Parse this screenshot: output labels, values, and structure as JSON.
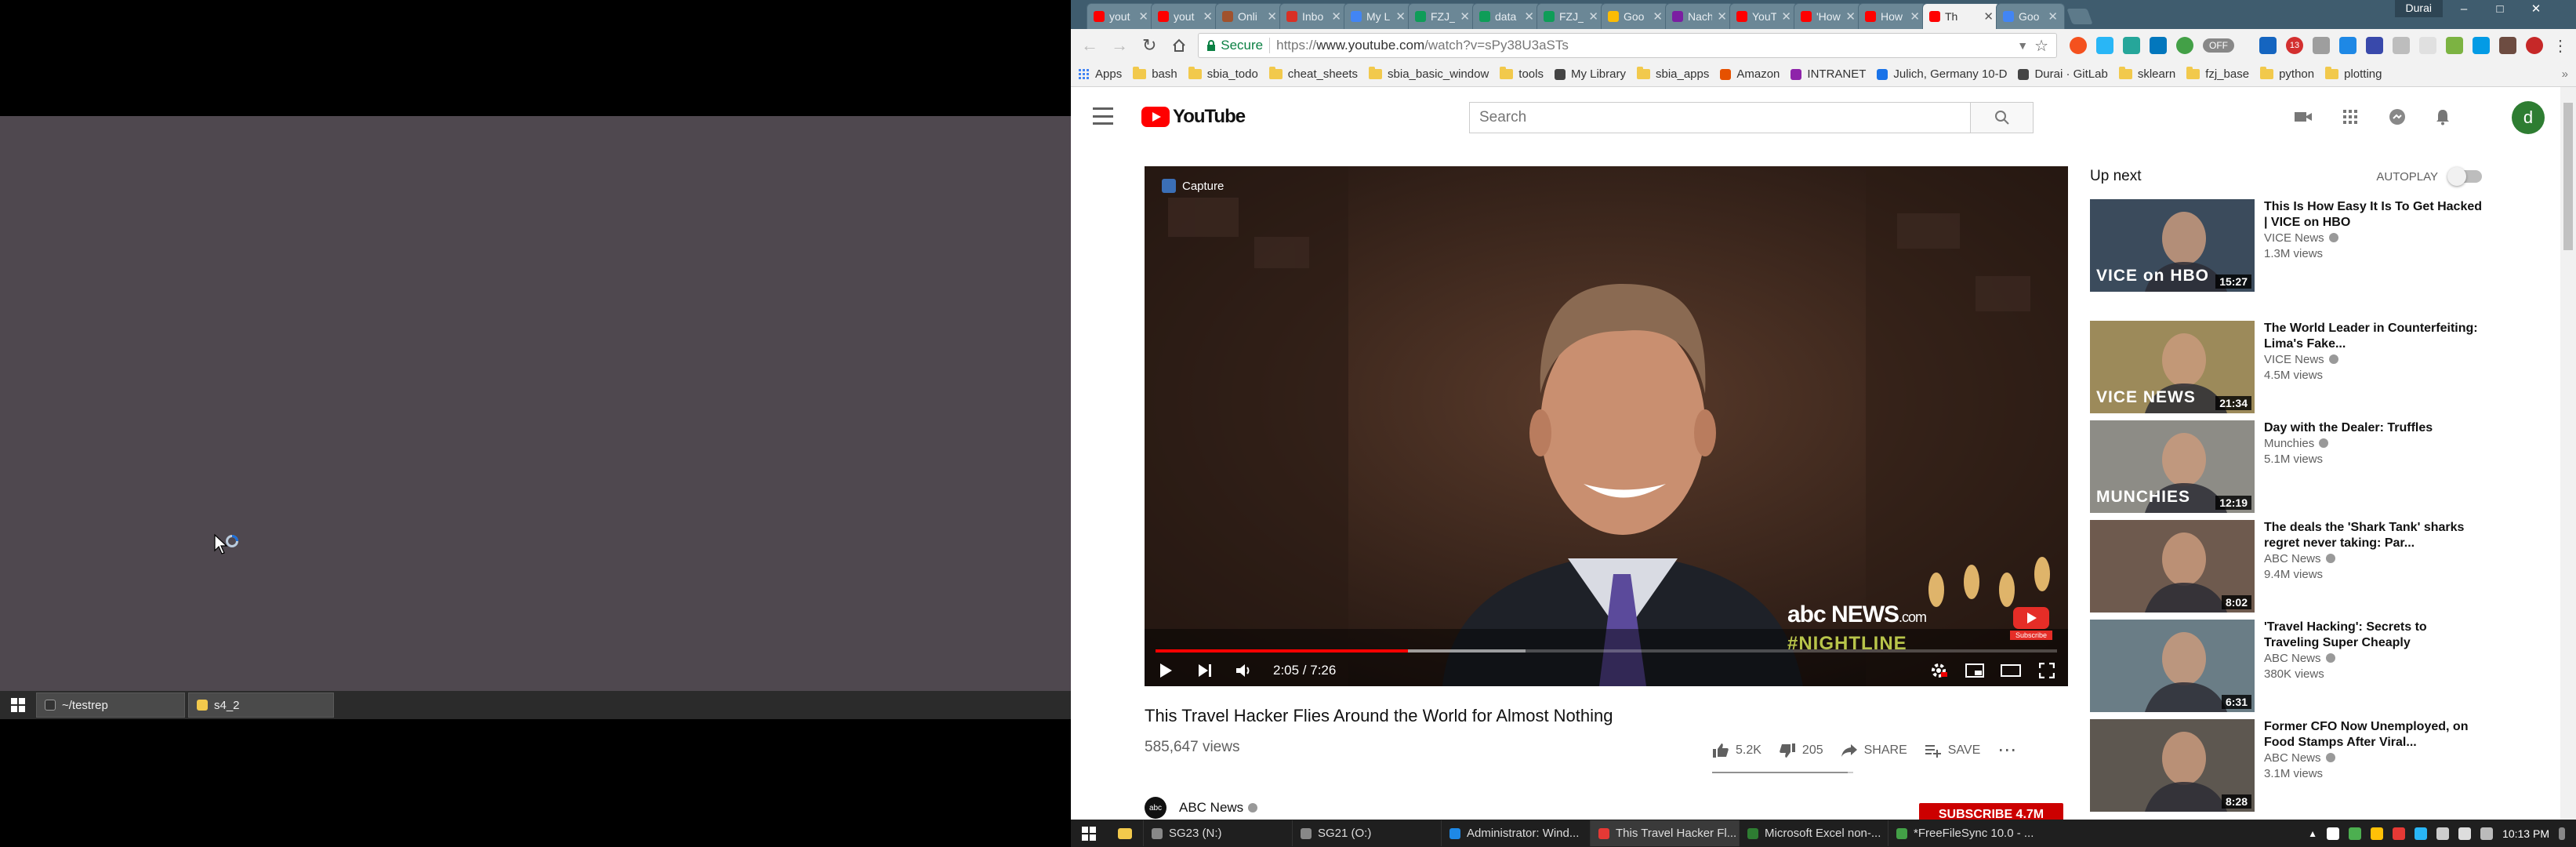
{
  "left_taskbar": {
    "buttons": [
      "~/testrep",
      "s4_2"
    ]
  },
  "browser": {
    "tabs": [
      {
        "label": "yout",
        "color": "#ff0000"
      },
      {
        "label": "yout",
        "color": "#ff0000"
      },
      {
        "label": "Onli",
        "color": "#a0522d"
      },
      {
        "label": "Inbo",
        "color": "#d93025"
      },
      {
        "label": "My L",
        "color": "#4285f4"
      },
      {
        "label": "FZJ_S",
        "color": "#0f9d58"
      },
      {
        "label": "data",
        "color": "#0f9d58"
      },
      {
        "label": "FZJ_I",
        "color": "#0f9d58"
      },
      {
        "label": "Goo",
        "color": "#fbbc05"
      },
      {
        "label": "Nach",
        "color": "#7b1fa2"
      },
      {
        "label": "YouT",
        "color": "#ff0000"
      },
      {
        "label": "'How",
        "color": "#ff0000"
      },
      {
        "label": "How",
        "color": "#ff0000"
      },
      {
        "label": "Th",
        "color": "#ff0000",
        "active": true
      },
      {
        "label": "Goo",
        "color": "#4285f4"
      }
    ],
    "user_name": "Durai",
    "secure_label": "Secure",
    "url_scheme": "https://",
    "url_host": "www.youtube.com",
    "url_path": "/watch?v=sPy38U3aSTs",
    "bookmarks": [
      {
        "label": "Apps",
        "kind": "apps"
      },
      {
        "label": "bash",
        "kind": "folder"
      },
      {
        "label": "sbia_todo",
        "kind": "folder"
      },
      {
        "label": "cheat_sheets",
        "kind": "folder"
      },
      {
        "label": "sbia_basic_window",
        "kind": "folder"
      },
      {
        "label": "tools",
        "kind": "folder"
      },
      {
        "label": "My Library",
        "kind": "site"
      },
      {
        "label": "sbia_apps",
        "kind": "folder"
      },
      {
        "label": "Amazon",
        "kind": "site"
      },
      {
        "label": "INTRANET",
        "kind": "site"
      },
      {
        "label": "Julich, Germany 10-D",
        "kind": "site"
      },
      {
        "label": "Durai · GitLab",
        "kind": "site"
      },
      {
        "label": "sklearn",
        "kind": "folder"
      },
      {
        "label": "fzj_base",
        "kind": "folder"
      },
      {
        "label": "python",
        "kind": "folder"
      },
      {
        "label": "plotting",
        "kind": "folder"
      }
    ],
    "off_badge": "OFF",
    "ext_badge": "13"
  },
  "youtube": {
    "logo_text": "YouTube",
    "search_placeholder": "Search",
    "avatar_letter": "d",
    "player": {
      "capture_label": "Capture",
      "time": "2:05 / 7:26",
      "progress": 0.28,
      "buffered": 0.41,
      "watermark": "abc NEWS",
      "watermark_sub": ".com",
      "show_label": "#NIGHTLINE",
      "subscribe_watermark": "Subscribe"
    },
    "video": {
      "title": "This Travel Hacker Flies Around the World for Almost Nothing",
      "views": "585,647 views",
      "likes": "5.2K",
      "dislikes": "205",
      "share_label": "SHARE",
      "save_label": "SAVE",
      "channel": "ABC News",
      "channel_logo": "abc",
      "subscribe_label": "SUBSCRIBE 4.7M"
    },
    "upnext": {
      "title": "Up next",
      "autoplay_label": "AUTOPLAY",
      "items": [
        {
          "title": "This Is How Easy It Is To Get Hacked | VICE on HBO",
          "channel": "VICE News",
          "views": "1.3M views",
          "duration": "15:27",
          "label": "VICE on HBO",
          "bg": "#3b4b5c"
        },
        {
          "title": "The World Leader in Counterfeiting: Lima's Fake...",
          "channel": "VICE News",
          "views": "4.5M views",
          "duration": "21:34",
          "label": "VICE NEWS",
          "bg": "#9c8a5a"
        },
        {
          "title": "Day with the Dealer: Truffles",
          "channel": "Munchies",
          "views": "5.1M views",
          "duration": "12:19",
          "label": "MUNCHIES",
          "bg": "#8d8c86"
        },
        {
          "title": "The deals the 'Shark Tank' sharks regret never taking: Par...",
          "channel": "ABC News",
          "views": "9.4M views",
          "duration": "8:02",
          "label": "",
          "bg": "#6e5a4e"
        },
        {
          "title": "'Travel Hacking': Secrets to Traveling Super Cheaply",
          "channel": "ABC News",
          "views": "380K views",
          "duration": "6:31",
          "label": "",
          "bg": "#6a7d86"
        },
        {
          "title": "Former CFO Now Unemployed, on Food Stamps After Viral...",
          "channel": "ABC News",
          "views": "3.1M views",
          "duration": "8:28",
          "label": "",
          "bg": "#5d5750"
        }
      ]
    }
  },
  "right_taskbar": {
    "buttons": [
      {
        "label": "SG23 (N:)",
        "active": false
      },
      {
        "label": "SG21 (O:)",
        "active": false
      },
      {
        "label": "Administrator: Wind...",
        "active": false
      },
      {
        "label": "This Travel Hacker Fl...",
        "active": true
      },
      {
        "label": "Microsoft Excel non-...",
        "active": false
      },
      {
        "label": "*FreeFileSync 10.0 - ...",
        "active": false
      }
    ],
    "clock": "10:13 PM"
  }
}
